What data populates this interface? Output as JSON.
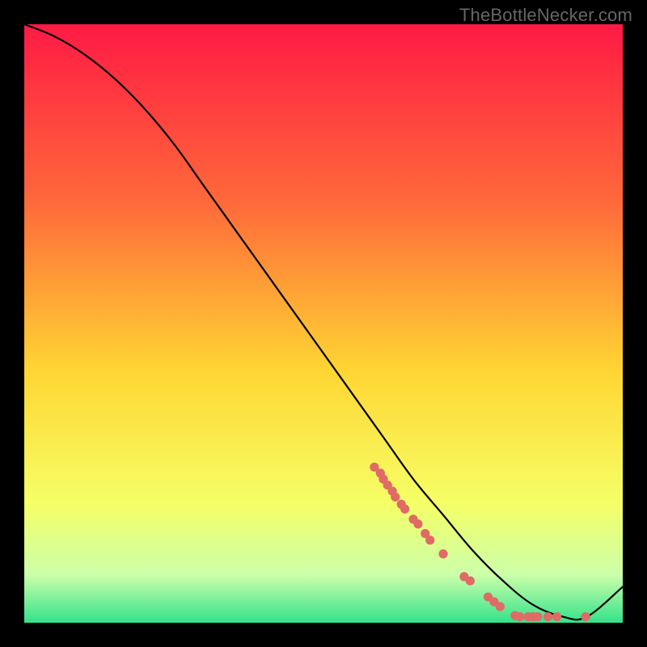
{
  "watermark": "TheBottleNecker.com",
  "colors": {
    "gradient_top": "#ff1a44",
    "gradient_mid1": "#ff6a3a",
    "gradient_mid2": "#ffd633",
    "gradient_mid3": "#f5ff66",
    "gradient_mid4": "#ccffaa",
    "gradient_bottom": "#33e28a",
    "line": "#000000",
    "dot": "#e06a65"
  },
  "chart_data": {
    "type": "line",
    "title": "",
    "xlabel": "",
    "ylabel": "",
    "xlim": [
      0,
      100
    ],
    "ylim": [
      0,
      100
    ],
    "grid": false,
    "legend": false,
    "series": [
      {
        "name": "curve",
        "x": [
          0,
          5,
          10,
          15,
          20,
          25,
          30,
          35,
          40,
          45,
          50,
          55,
          60,
          65,
          70,
          75,
          80,
          85,
          90,
          94,
          100
        ],
        "y": [
          100,
          98,
          95,
          91,
          86,
          80,
          73,
          66,
          59,
          52,
          45,
          38,
          31,
          24,
          18,
          12,
          7,
          3,
          1,
          1,
          6
        ],
        "render": "line"
      },
      {
        "name": "markers",
        "x": [
          58.5,
          59.5,
          60.0,
          60.7,
          61.5,
          62.0,
          63.0,
          63.6,
          65.0,
          65.8,
          67.0,
          67.8,
          70.0,
          73.5,
          74.5,
          77.5,
          78.5,
          79.5,
          82.0,
          82.8,
          84.2,
          85.0,
          85.8,
          87.5,
          89.0,
          93.8
        ],
        "y": [
          26.0,
          25.0,
          24.0,
          23.0,
          22.0,
          21.0,
          19.8,
          19.0,
          17.3,
          16.5,
          14.9,
          13.8,
          11.5,
          7.7,
          7.0,
          4.3,
          3.5,
          2.7,
          1.2,
          1.0,
          1.0,
          1.0,
          1.0,
          1.0,
          1.0,
          1.0
        ],
        "render": "scatter"
      }
    ]
  }
}
